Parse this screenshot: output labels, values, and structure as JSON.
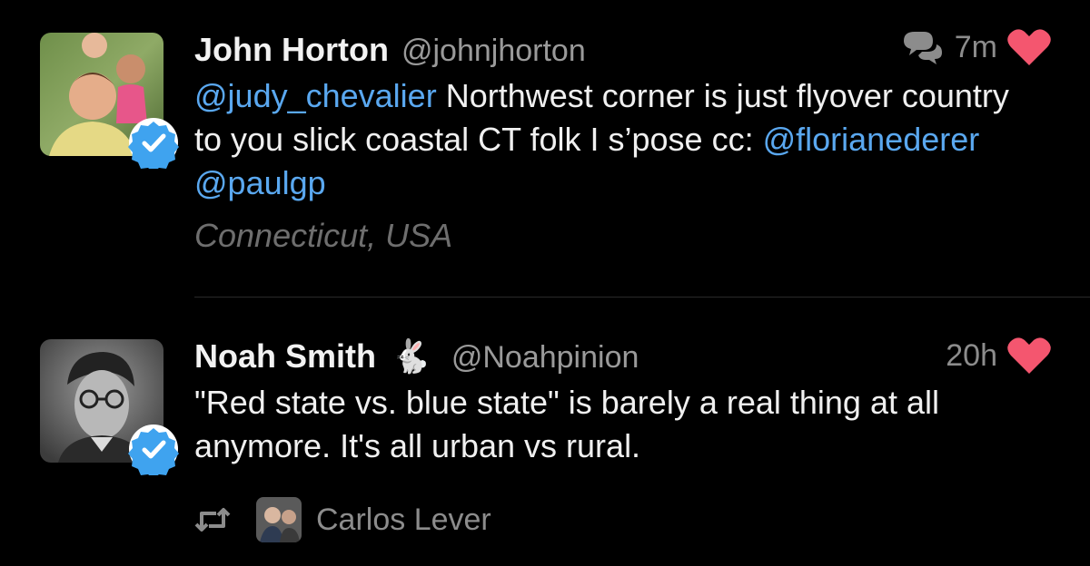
{
  "tweets": [
    {
      "author_name": "John Horton",
      "author_handle": "@johnjhorton",
      "time": "7m",
      "verified": true,
      "liked": true,
      "has_conversation": true,
      "body": {
        "mention1": "@judy_chevalier",
        "text1": " Northwest corner is just flyover country to you slick coastal CT folk I s’pose cc: ",
        "mention2": "@florianederer",
        "text2": " ",
        "mention3": "@paulgp"
      },
      "location": "Connecticut, USA"
    },
    {
      "author_name": "Noah Smith",
      "author_emoji": "🐇",
      "author_handle": "@Noahpinion",
      "time": "20h",
      "verified": true,
      "liked": true,
      "body_text": "\"Red state vs. blue state\" is barely a real thing at all anymore. It's all urban vs rural.",
      "retweeted_by": "Carlos Lever"
    }
  ],
  "colors": {
    "background": "#000000",
    "mention": "#5aa8f0",
    "like_heart": "#f4566f",
    "verified_badge": "#3fa3ef"
  },
  "icons": [
    "conversation-icon",
    "heart-icon",
    "verified-badge-icon",
    "retweet-icon"
  ]
}
